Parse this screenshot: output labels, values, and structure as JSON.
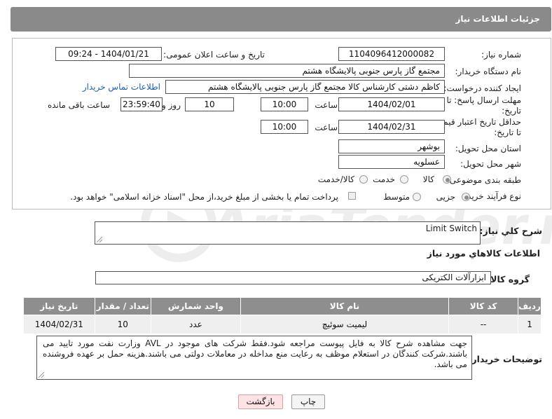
{
  "header": {
    "title": "جزئیات اطلاعات نیاز"
  },
  "form": {
    "need_number": {
      "label": "شماره نیاز:",
      "value": "1104096412000082"
    },
    "announce": {
      "label": "تاریخ و ساعت اعلان عمومی:",
      "value": "1404/01/21 - 09:24"
    },
    "buyer_org": {
      "label": "نام دستگاه خریدار:",
      "value": "مجتمع گاز پارس جنوبی  پالایشگاه هشتم"
    },
    "creator": {
      "label": "ایجاد کننده درخواست:",
      "value": "کاظم دشتی کارشناس کالا مجتمع گاز پارس جنوبی  پالایشگاه هشتم",
      "contact_link": "اطلاعات تماس خریدار"
    },
    "reply_deadline": {
      "label_line1": "مهلت ارسال پاسخ: تا",
      "label_line2": "تاریخ:",
      "date": "1404/02/01",
      "time_label": "ساعت",
      "time": "10:00",
      "days": "10",
      "days_label": "روز و",
      "remaining": "23:59:40",
      "remaining_label": "ساعت باقی مانده"
    },
    "price_validity": {
      "label_line1": "حداقل تاریخ اعتبار قیمت:",
      "label_line2": "تا تاریخ:",
      "date": "1404/02/31",
      "time_label": "ساعت",
      "time": "10:00"
    },
    "province": {
      "label": "استان محل تحویل:",
      "value": "بوشهر"
    },
    "city": {
      "label": "شهر محل تحویل:",
      "value": "عسلویه"
    },
    "category": {
      "label": "طبقه بندی موضوعی:",
      "options": [
        "کالا",
        "خدمت",
        "کالا/خدمت"
      ],
      "selected": "کالا"
    },
    "process": {
      "label": "نوع فرآیند خرید :",
      "options": [
        "جزیی",
        "متوسط"
      ],
      "selected": "جزیی",
      "payment_note": "پرداخت تمام یا بخشی از مبلغ خرید،از محل \"اسناد خزانه اسلامی\" خواهد بود."
    }
  },
  "summary": {
    "label": "شرح کلي نياز:",
    "value": "Limit Switch"
  },
  "goods_section": {
    "title": "اطلاعات کالاهاي مورد نياز",
    "group_label": "گروه کالا:",
    "group_value": "ابزارآلات الکتریکی"
  },
  "table": {
    "headers": [
      "ردیف",
      "کد کالا",
      "نام کالا",
      "واحد شمارش",
      "تعداد / مقدار",
      "تاریخ نیاز"
    ],
    "rows": [
      [
        "1",
        "--",
        "لیمیت سوئیچ",
        "عدد",
        "10",
        "1404/02/31"
      ]
    ]
  },
  "buyer_notes": {
    "label": "توضیحات خریدار:",
    "value": "جهت مشاهده شرح کالا به فایل پیوست مراجعه شود.فقط شرکت های موجود در AVL وزارت نفت مورد تایید می باشند.شرکت کنندگان در استعلام موظف به رعایت منع مداخله در معاملات دولتی می باشند.هزینه حمل بر عهده فروشنده می باشد."
  },
  "buttons": {
    "print": "چاپ",
    "back": "بازگشت"
  },
  "watermark": {
    "text": "AriaTender.net"
  }
}
